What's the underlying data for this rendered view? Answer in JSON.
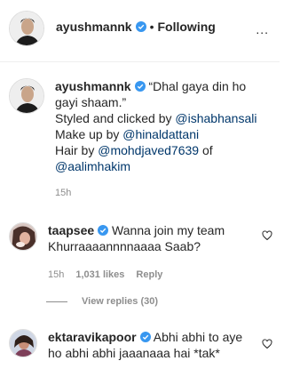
{
  "header": {
    "username": "ayushmannk",
    "dot": "•",
    "follow_status": "Following",
    "more_label": "..."
  },
  "caption": {
    "username": "ayushmannk",
    "text_line1": "“Dhal gaya din ho gayi shaam.”",
    "styled_prefix": "Styled and clicked by ",
    "styled_link": "@ishabhansali",
    "makeup_prefix": "Make up by ",
    "makeup_link": "@hinaldattani",
    "hair_prefix": "Hair by ",
    "hair_link": "@mohdjaved7639",
    "hair_of": " of",
    "hair_link2": "@aalimhakim",
    "time": "15h"
  },
  "comments": [
    {
      "username": "taapsee",
      "text": "Wanna join my team Khurraaaannnnaaaa Saab?",
      "time": "15h",
      "likes": "1,031 likes",
      "reply": "Reply"
    },
    {
      "username": "ektaravikapoor",
      "text": "Abhi abhi to aye ho abhi abhi jaaanaaa hai *tak*"
    }
  ],
  "view_replies": "View replies (30)",
  "colors": {
    "verified": "#3897f0",
    "link": "#00376b",
    "muted": "#8e8e8e"
  },
  "icons": [
    "verified-badge-icon",
    "heart-outline-icon",
    "more-options-icon"
  ]
}
